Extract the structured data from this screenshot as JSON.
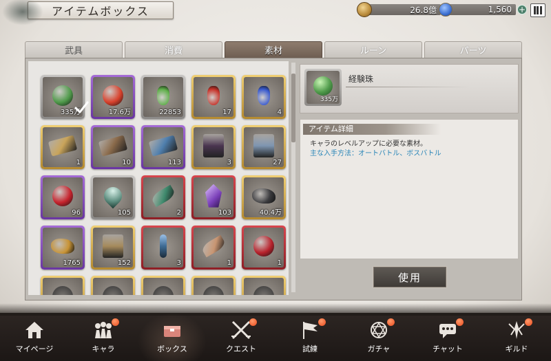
{
  "header": {
    "title": "アイテムボックス"
  },
  "currency": {
    "coins": "26.8億",
    "gems": "1,560",
    "add": "+"
  },
  "tabs": [
    {
      "label": "武具"
    },
    {
      "label": "消費"
    },
    {
      "label": "素材",
      "active": true
    },
    {
      "label": "ルーン"
    },
    {
      "label": "パーツ"
    }
  ],
  "items": [
    {
      "rarity": "gray",
      "count": "335万",
      "icon": "green-orb-icon",
      "color": "#4f9a4a",
      "selected": true
    },
    {
      "rarity": "purple",
      "count": "17.6万",
      "icon": "red-orb-icon",
      "color": "#d8412c"
    },
    {
      "rarity": "gray",
      "count": "22853",
      "icon": "green-potion-icon",
      "color": "#5fb04a"
    },
    {
      "rarity": "gold",
      "count": "17",
      "icon": "red-potion-icon",
      "color": "#c8342b"
    },
    {
      "rarity": "gold",
      "count": "4",
      "icon": "blue-potion-icon",
      "color": "#3a5bd0"
    },
    {
      "rarity": "gold",
      "count": "1",
      "icon": "gold-ticket-icon",
      "color": "#c9a45a"
    },
    {
      "rarity": "purple",
      "count": "10",
      "icon": "bronze-ticket-icon",
      "color": "#8a6a4a"
    },
    {
      "rarity": "purple",
      "count": "113",
      "icon": "blue-ticket-icon",
      "color": "#4f7fae"
    },
    {
      "rarity": "gold",
      "count": "3",
      "icon": "dark-scroll-icon",
      "color": "#4a3550"
    },
    {
      "rarity": "gold",
      "count": "27",
      "icon": "tower-scroll-icon",
      "color": "#7e95b0"
    },
    {
      "rarity": "purple",
      "count": "96",
      "icon": "red-fruit-icon",
      "color": "#c6232d"
    },
    {
      "rarity": "gray",
      "count": "105",
      "icon": "green-heart-icon",
      "color": "#5e8e80"
    },
    {
      "rarity": "red",
      "count": "2",
      "icon": "green-leaf-icon",
      "color": "#3f8a6d"
    },
    {
      "rarity": "red",
      "count": "103",
      "icon": "purple-crystal-icon",
      "color": "#7a3fb8"
    },
    {
      "rarity": "gold",
      "count": "40.4万",
      "icon": "dark-ore-icon",
      "color": "#3b3b3e"
    },
    {
      "rarity": "purple",
      "count": "1765",
      "icon": "gold-nuggets-icon",
      "color": "#c89335"
    },
    {
      "rarity": "gold",
      "count": "152",
      "icon": "parchment-icon",
      "color": "#a58a5c"
    },
    {
      "rarity": "red",
      "count": "3",
      "icon": "blue-key-icon",
      "color": "#3e6b94"
    },
    {
      "rarity": "red",
      "count": "1",
      "icon": "wing-icon",
      "color": "#c89572"
    },
    {
      "rarity": "red",
      "count": "1",
      "icon": "pomegranate-icon",
      "color": "#b8222c"
    },
    {
      "rarity": "gold",
      "count": "",
      "icon": "item-icon",
      "color": "#7a7672"
    },
    {
      "rarity": "gold",
      "count": "",
      "icon": "item-icon",
      "color": "#7a7672"
    },
    {
      "rarity": "gold",
      "count": "",
      "icon": "item-icon",
      "color": "#7a7672"
    },
    {
      "rarity": "gold",
      "count": "",
      "icon": "item-icon",
      "color": "#7a7672"
    },
    {
      "rarity": "gold",
      "count": "",
      "icon": "item-icon",
      "color": "#7a7672"
    }
  ],
  "detail": {
    "name": "経験珠",
    "count": "335万",
    "section_label": "アイテム詳細",
    "description": "キャラのレベルアップに必要な素材。",
    "source": "主な入手方法：オートバトル、ボスバトル",
    "use_button": "使用"
  },
  "nav": [
    {
      "label": "マイページ",
      "icon": "house-icon",
      "badge": false
    },
    {
      "label": "キャラ",
      "icon": "characters-icon",
      "badge": true
    },
    {
      "label": "ボックス",
      "icon": "box-icon",
      "badge": false,
      "active": true
    },
    {
      "label": "クエスト",
      "icon": "crossed-swords-icon",
      "badge": true
    },
    {
      "label": "試練",
      "icon": "flag-icon",
      "badge": true
    },
    {
      "label": "ガチャ",
      "icon": "magic-circle-icon",
      "badge": true
    },
    {
      "label": "チャット",
      "icon": "chat-icon",
      "badge": true
    },
    {
      "label": "ギルド",
      "icon": "guild-emblem-icon",
      "badge": true
    }
  ]
}
